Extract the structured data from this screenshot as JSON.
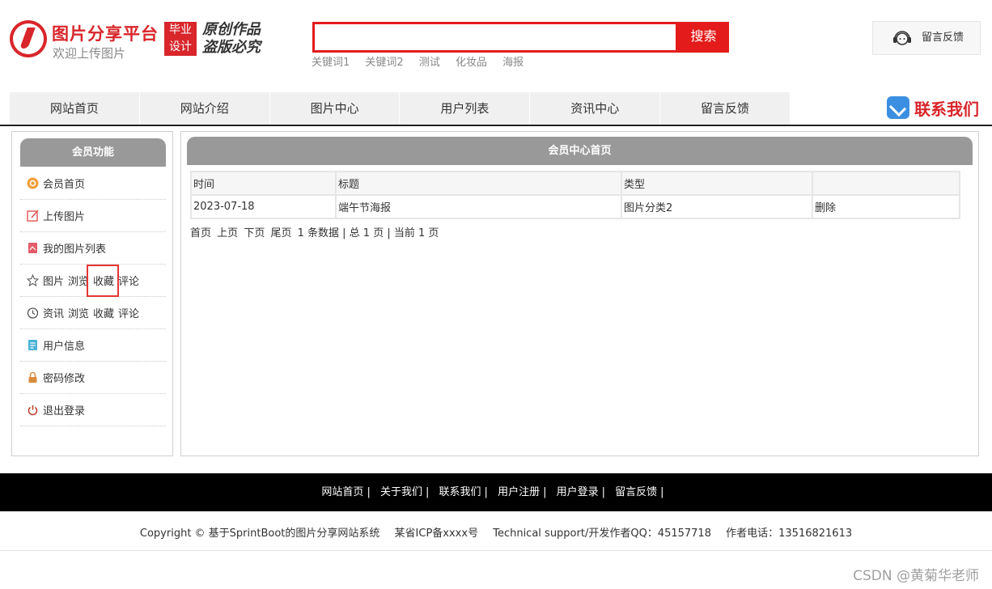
{
  "header": {
    "site_name": "图片分享平台",
    "site_sub": "欢迎上传图片",
    "stamp_line1": "毕业",
    "stamp_line2": "设计",
    "slogan_line1": "原创作品",
    "slogan_line2": "盗版必究",
    "search_placeholder": "",
    "search_button": "搜索",
    "keywords": [
      "关键词1",
      "关键词2",
      "测试",
      "化妆品",
      "海报"
    ],
    "feedback_label": "留言反馈"
  },
  "nav": {
    "items": [
      "网站首页",
      "网站介绍",
      "图片中心",
      "用户列表",
      "资讯中心",
      "留言反馈"
    ],
    "contact_label": "联系我们"
  },
  "sidebar": {
    "title": "会员功能",
    "items": [
      {
        "label": "会员首页",
        "icon": "member-home-icon"
      },
      {
        "label": "上传图片",
        "icon": "upload-icon"
      },
      {
        "label": "我的图片列表",
        "icon": "image-list-icon"
      },
      {
        "label": "图片",
        "icon": "star-icon",
        "links": [
          "浏览",
          "收藏",
          "评论"
        ]
      },
      {
        "label": "资讯",
        "icon": "history-icon",
        "links": [
          "浏览",
          "收藏",
          "评论"
        ]
      },
      {
        "label": "用户信息",
        "icon": "user-info-icon"
      },
      {
        "label": "密码修改",
        "icon": "lock-icon"
      },
      {
        "label": "退出登录",
        "icon": "power-icon"
      }
    ]
  },
  "main": {
    "title": "会员中心首页",
    "columns": [
      "时间",
      "标题",
      "类型",
      ""
    ],
    "rows": [
      {
        "time": "2023-07-18",
        "title": "端午节海报",
        "type": "图片分类2",
        "action": "删除"
      }
    ],
    "pager": {
      "first": "首页",
      "prev": "上页",
      "next": "下页",
      "last": "尾页",
      "summary": "1 条数据 | 总 1 页 | 当前 1 页"
    }
  },
  "footer": {
    "links": [
      "网站首页",
      "关于我们",
      "联系我们",
      "用户注册",
      "用户登录",
      "留言反馈"
    ],
    "copyright": "Copyright © 基于SprintBoot的图片分享网站系统",
    "icp": "某省ICP备xxxx号",
    "support": "Technical support/开发作者QQ：45157718",
    "phone": "作者电话：13516821613"
  },
  "watermark": "CSDN @黄菊华老师",
  "colors": {
    "brand_red": "#d8262b",
    "search_red": "#e31b1b",
    "panel_gray": "#999999",
    "highlight": "#e53535"
  }
}
